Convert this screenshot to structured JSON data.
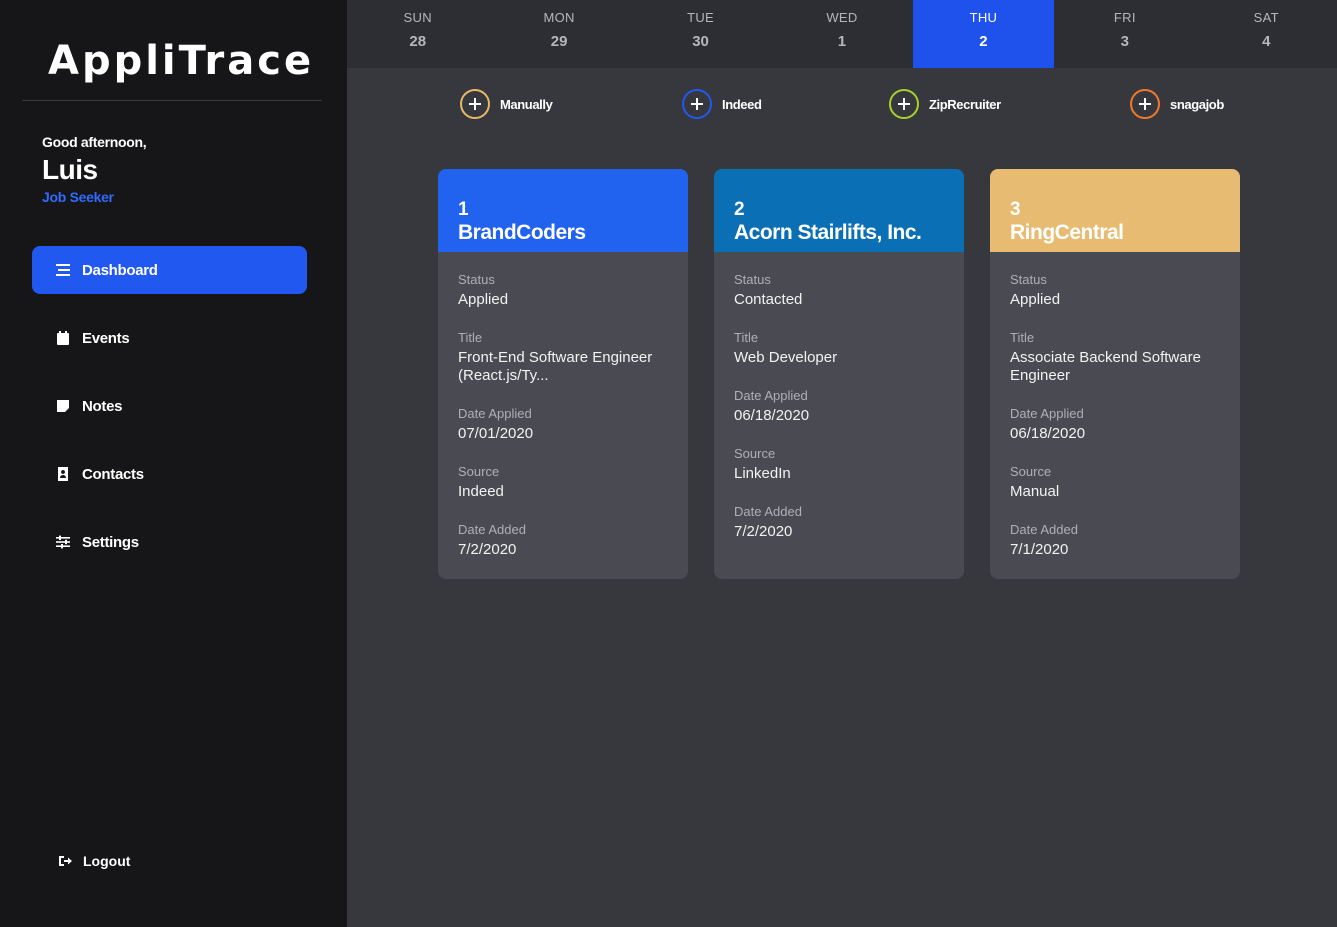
{
  "app": {
    "title": "AppliTrace"
  },
  "user": {
    "greeting": "Good afternoon,",
    "name": "Luis",
    "role": "Job Seeker"
  },
  "nav": {
    "items": [
      {
        "label": "Dashboard",
        "icon": "list-icon",
        "active": true
      },
      {
        "label": "Events",
        "icon": "calendar-icon",
        "active": false
      },
      {
        "label": "Notes",
        "icon": "note-icon",
        "active": false
      },
      {
        "label": "Contacts",
        "icon": "contact-icon",
        "active": false
      },
      {
        "label": "Settings",
        "icon": "sliders-icon",
        "active": false
      }
    ],
    "logout": "Logout"
  },
  "week": [
    {
      "name": "SUN",
      "num": "28"
    },
    {
      "name": "MON",
      "num": "29"
    },
    {
      "name": "TUE",
      "num": "30"
    },
    {
      "name": "WED",
      "num": "1"
    },
    {
      "name": "THU",
      "num": "2",
      "active": true
    },
    {
      "name": "FRI",
      "num": "3"
    },
    {
      "name": "SAT",
      "num": "4"
    }
  ],
  "sources": [
    {
      "label": "Manually",
      "color": "#e8b86a"
    },
    {
      "label": "Indeed",
      "color": "#2158f0"
    },
    {
      "label": "ZipRecruiter",
      "color": "#a8d22a"
    },
    {
      "label": "snagajob",
      "color": "#f07a2a"
    }
  ],
  "cards": [
    {
      "num": "1",
      "company": "BrandCoders",
      "color": "#2162ee",
      "status_label": "Status",
      "status": "Applied",
      "title_label": "Title",
      "title": "Front-End Software Engineer (React.js/Ty...",
      "date_applied_label": "Date Applied",
      "date_applied": "07/01/2020",
      "source_label": "Source",
      "source": "Indeed",
      "date_added_label": "Date Added",
      "date_added": "7/2/2020"
    },
    {
      "num": "2",
      "company": "Acorn Stairlifts, Inc.",
      "color": "#0a6fb4",
      "status_label": "Status",
      "status": "Contacted",
      "title_label": "Title",
      "title": "Web Developer",
      "date_applied_label": "Date Applied",
      "date_applied": "06/18/2020",
      "source_label": "Source",
      "source": "LinkedIn",
      "date_added_label": "Date Added",
      "date_added": "7/2/2020"
    },
    {
      "num": "3",
      "company": "RingCentral",
      "color": "#e8bb72",
      "status_label": "Status",
      "status": "Applied",
      "title_label": "Title",
      "title": "Associate Backend Software Engineer",
      "date_applied_label": "Date Applied",
      "date_applied": "06/18/2020",
      "source_label": "Source",
      "source": "Manual",
      "date_added_label": "Date Added",
      "date_added": "7/1/2020"
    }
  ]
}
